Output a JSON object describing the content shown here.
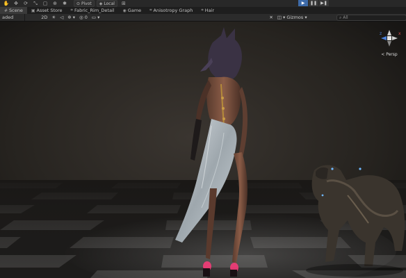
{
  "toolbar": {
    "pivot_label": "Pivot",
    "local_label": "Local"
  },
  "tabs": [
    {
      "label": "Scene",
      "icon": "grid-icon"
    },
    {
      "label": "Asset Store",
      "icon": "bag-icon"
    },
    {
      "label": "Fabric_Rim_Detail",
      "icon": "graph-icon"
    },
    {
      "label": "Game",
      "icon": "gamepad-icon"
    },
    {
      "label": "Anisotropy Graph",
      "icon": "graph-icon"
    },
    {
      "label": "Hair",
      "icon": "graph-icon"
    }
  ],
  "scene_toolbar": {
    "shading_mode": "aded",
    "mode_2d": "2D",
    "gizmos_label": "Gizmos",
    "search_placeholder": "All"
  },
  "gizmo": {
    "z_axis": "z",
    "x_axis": "x",
    "projection_label": "< Persp"
  },
  "colors": {
    "play_active": "#3d6aa8",
    "shoe_glow": "#ff3a7a",
    "tail_light": "#6fb8ff"
  }
}
